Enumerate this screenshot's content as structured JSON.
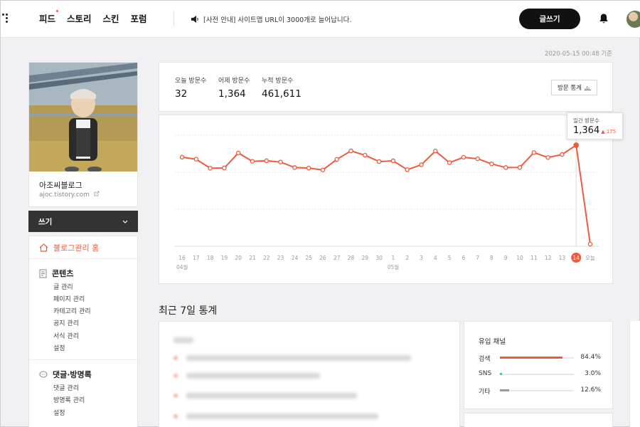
{
  "nav": {
    "items": [
      "피드",
      "스토리",
      "스킨",
      "포럼"
    ],
    "notice": "[사전 안내] 사이트맵 URL이 3000개로 늘어납니다.",
    "write_label": "글쓰기"
  },
  "timestamp": "2020-05-15 00:48 기준",
  "profile": {
    "blog_name": "아조씨블로그",
    "blog_url": "ajoc.tistory.com"
  },
  "sidebar": {
    "write_dropdown": "쓰기",
    "home": "블로그관리 홈",
    "sections": [
      {
        "title": "콘텐츠",
        "items": [
          "글 관리",
          "페이지 관리",
          "카테고리 관리",
          "공지 관리",
          "서식 관리",
          "설정"
        ]
      },
      {
        "title": "댓글·방명록",
        "items": [
          "댓글 관리",
          "방명록 관리",
          "설정"
        ]
      }
    ]
  },
  "stats": {
    "today_label": "오늘 방문수",
    "today_value": "32",
    "yesterday_label": "어제 방문수",
    "yesterday_value": "1,364",
    "total_label": "누적 방문수",
    "total_value": "461,611",
    "button_label": "방문 통계"
  },
  "tooltip": {
    "label": "일간 방문수",
    "value": "1,364",
    "delta": "▲ 175"
  },
  "chart_data": {
    "type": "line",
    "x": [
      "16",
      "17",
      "18",
      "19",
      "20",
      "21",
      "22",
      "23",
      "24",
      "25",
      "26",
      "27",
      "28",
      "29",
      "30",
      "1",
      "2",
      "3",
      "4",
      "5",
      "6",
      "7",
      "8",
      "9",
      "10",
      "11",
      "12",
      "13",
      "14",
      "오늘"
    ],
    "month_labels": [
      "04월",
      "05월"
    ],
    "series": [
      {
        "values": [
          1202,
          1175,
          1054,
          1057,
          1259,
          1146,
          1154,
          1137,
          1063,
          1056,
          1030,
          1173,
          1287,
          1229,
          1143,
          1153,
          1034,
          1100,
          1285,
          1129,
          1201,
          1181,
          1112,
          1063,
          1064,
          1265,
          1198,
          1239,
          1364,
          32
        ]
      }
    ],
    "highlight_index": 28,
    "colors": {
      "line": "#ef5a3c",
      "highlight": "#ef5a3c"
    }
  },
  "recent_title": "최근 7일 통계",
  "inflow": {
    "title": "유입 채널",
    "channels": [
      {
        "name": "검색",
        "pct": "84.4%",
        "value": 0.844,
        "color": "#ef5a3c"
      },
      {
        "name": "SNS",
        "pct": "3.0%",
        "value": 0.03,
        "color": "#2cc9b3"
      },
      {
        "name": "기타",
        "pct": "12.6%",
        "value": 0.126,
        "color": "#9a9a9e"
      }
    ]
  }
}
